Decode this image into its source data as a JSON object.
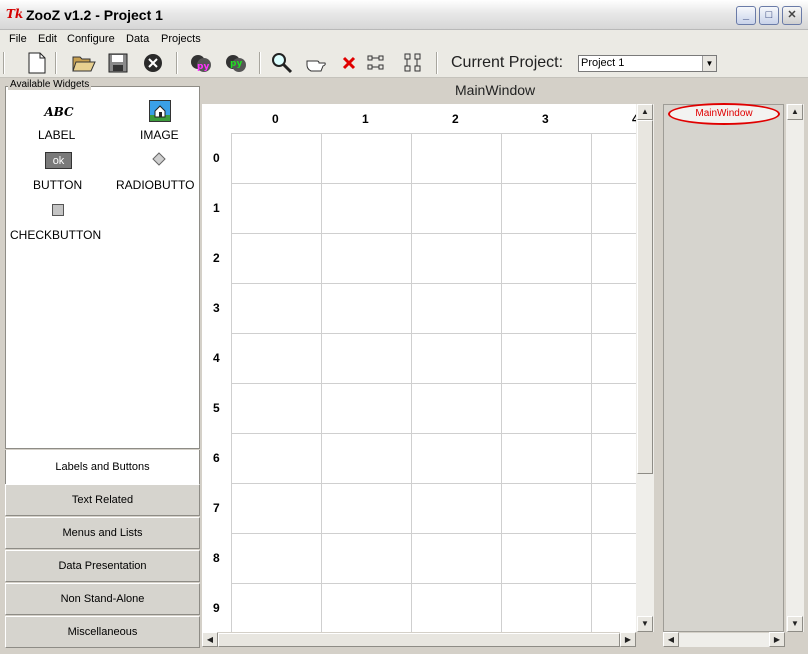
{
  "window": {
    "title": "ZooZ v1.2 - Project 1",
    "app_icon_text": "Tk"
  },
  "window_controls": {
    "minimize": "_",
    "maximize": "□",
    "close": "✕"
  },
  "menu": [
    "File",
    "Edit",
    "Configure",
    "Data",
    "Projects"
  ],
  "toolbar": {
    "current_project_label": "Current Project:",
    "current_project_value": "Project 1"
  },
  "left_panel": {
    "caption": "Available Widgets",
    "widgets": [
      {
        "label": "LABEL",
        "icon": "abc-icon",
        "icon_text": "ABC"
      },
      {
        "label": "IMAGE",
        "icon": "image-icon"
      },
      {
        "label": "BUTTON",
        "icon": "button-icon",
        "icon_text": "ok"
      },
      {
        "label": "RADIOBUTTO",
        "icon": "radiobutton-icon"
      },
      {
        "label": "CHECKBUTTON",
        "icon": "checkbutton-icon"
      }
    ],
    "categories": [
      "Labels and Buttons",
      "Text Related",
      "Menus and Lists",
      "Data Presentation",
      "Non Stand-Alone",
      "Miscellaneous"
    ],
    "active_category": "Labels and Buttons"
  },
  "canvas": {
    "title": "MainWindow",
    "columns": [
      "0",
      "1",
      "2",
      "3"
    ],
    "rows": [
      "0",
      "1",
      "2",
      "3",
      "4",
      "5",
      "6",
      "7",
      "8",
      "9"
    ]
  },
  "tree": {
    "root": "MainWindow"
  },
  "colors": {
    "tree_node": "#e00000",
    "active_tab": "#ffffff"
  }
}
